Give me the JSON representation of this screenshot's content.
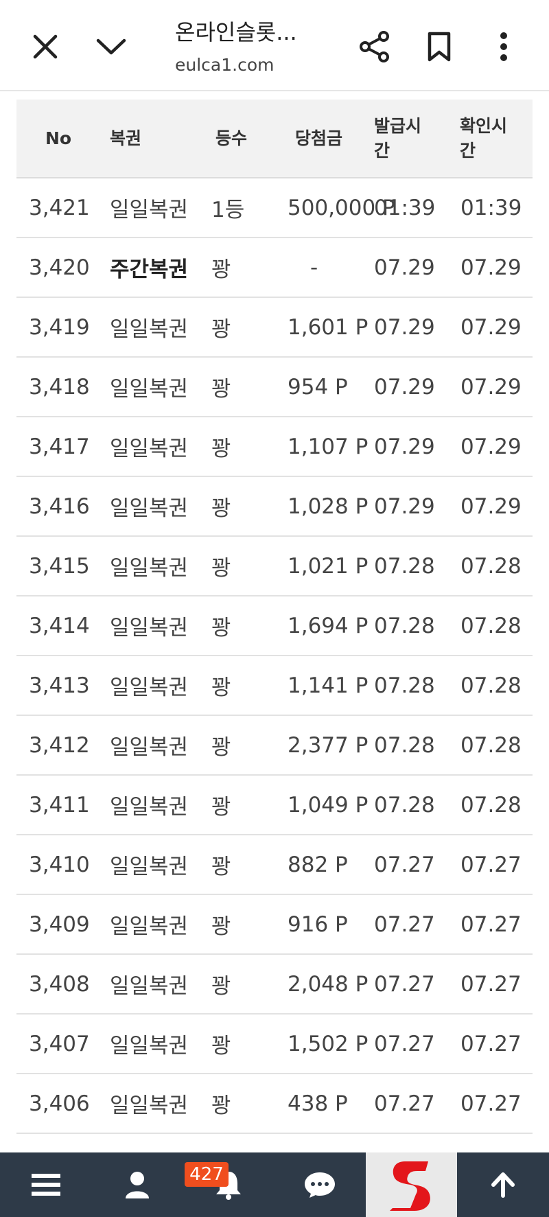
{
  "browser": {
    "title": "온라인슬롯...",
    "url": "eulca1.com"
  },
  "table": {
    "headers": {
      "no": "No",
      "type": "복권",
      "rank": "등수",
      "prize": "당첨금",
      "issue": "발급시간",
      "check": "확인시간"
    },
    "rows": [
      {
        "no": "3,421",
        "type": "일일복권",
        "rank": "1등",
        "prize": "500,000 P",
        "issue": "01:39",
        "check": "01:39"
      },
      {
        "no": "3,420",
        "type": "주간복권",
        "rank": "꽝",
        "prize": "-",
        "issue": "07.29",
        "check": "07.29"
      },
      {
        "no": "3,419",
        "type": "일일복권",
        "rank": "꽝",
        "prize": "1,601 P",
        "issue": "07.29",
        "check": "07.29"
      },
      {
        "no": "3,418",
        "type": "일일복권",
        "rank": "꽝",
        "prize": "954 P",
        "issue": "07.29",
        "check": "07.29"
      },
      {
        "no": "3,417",
        "type": "일일복권",
        "rank": "꽝",
        "prize": "1,107 P",
        "issue": "07.29",
        "check": "07.29"
      },
      {
        "no": "3,416",
        "type": "일일복권",
        "rank": "꽝",
        "prize": "1,028 P",
        "issue": "07.29",
        "check": "07.29"
      },
      {
        "no": "3,415",
        "type": "일일복권",
        "rank": "꽝",
        "prize": "1,021 P",
        "issue": "07.28",
        "check": "07.28"
      },
      {
        "no": "3,414",
        "type": "일일복권",
        "rank": "꽝",
        "prize": "1,694 P",
        "issue": "07.28",
        "check": "07.28"
      },
      {
        "no": "3,413",
        "type": "일일복권",
        "rank": "꽝",
        "prize": "1,141 P",
        "issue": "07.28",
        "check": "07.28"
      },
      {
        "no": "3,412",
        "type": "일일복권",
        "rank": "꽝",
        "prize": "2,377 P",
        "issue": "07.28",
        "check": "07.28"
      },
      {
        "no": "3,411",
        "type": "일일복권",
        "rank": "꽝",
        "prize": "1,049 P",
        "issue": "07.28",
        "check": "07.28"
      },
      {
        "no": "3,410",
        "type": "일일복권",
        "rank": "꽝",
        "prize": "882 P",
        "issue": "07.27",
        "check": "07.27"
      },
      {
        "no": "3,409",
        "type": "일일복권",
        "rank": "꽝",
        "prize": "916 P",
        "issue": "07.27",
        "check": "07.27"
      },
      {
        "no": "3,408",
        "type": "일일복권",
        "rank": "꽝",
        "prize": "2,048 P",
        "issue": "07.27",
        "check": "07.27"
      },
      {
        "no": "3,407",
        "type": "일일복권",
        "rank": "꽝",
        "prize": "1,502 P",
        "issue": "07.27",
        "check": "07.27"
      },
      {
        "no": "3,406",
        "type": "일일복권",
        "rank": "꽝",
        "prize": "438 P",
        "issue": "07.27",
        "check": "07.27"
      }
    ]
  },
  "bottom_bar": {
    "notification_count": "427",
    "icons": [
      "menu-icon",
      "user-icon",
      "bell-icon",
      "chat-icon",
      "site-logo",
      "arrow-up-icon"
    ]
  },
  "colors": {
    "bottom_bar_bg": "#2e3a48",
    "badge_bg": "#f04e1e",
    "logo_red": "#e3161b",
    "header_bg": "#f2f2f2"
  }
}
